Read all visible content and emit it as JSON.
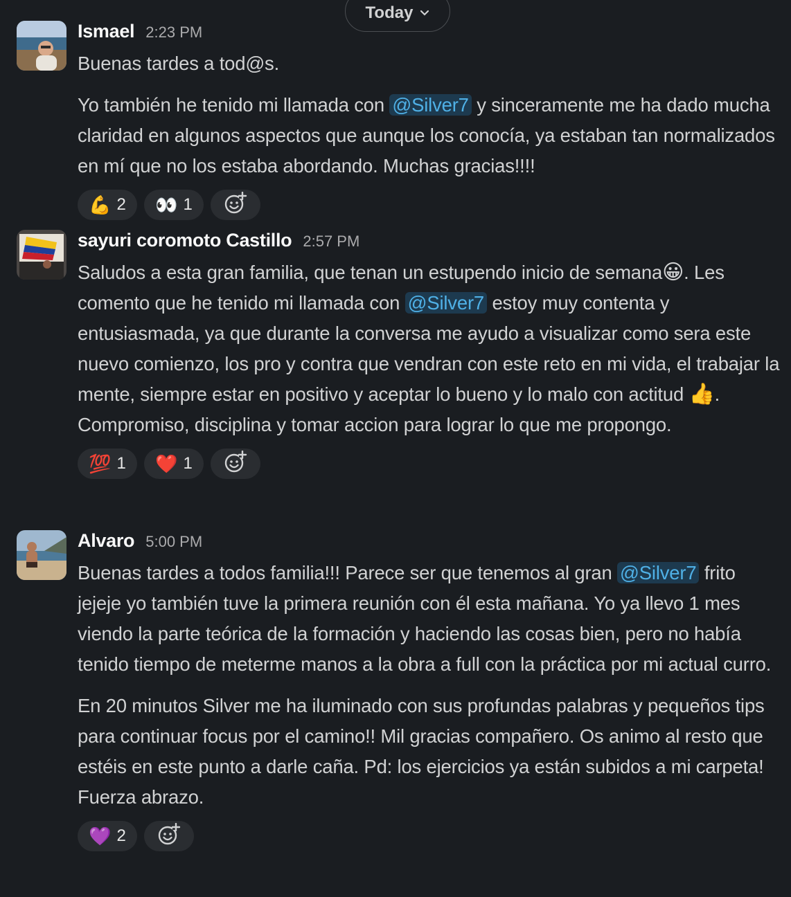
{
  "day_divider": {
    "label": "Today",
    "chevron_icon": "chevron-down-icon"
  },
  "colors": {
    "background": "#1a1d21",
    "mention_bg": "#1d3a4f",
    "mention_text": "#4fb0e6",
    "reaction_bg": "#2a2d31"
  },
  "messages": [
    {
      "author": "Ismael",
      "time": "2:23 PM",
      "line1": "Buenas tardes a tod@s.",
      "line2_pre": "Yo también he tenido mi llamada con ",
      "mention": "@Silver7",
      "line2_post": " y sinceramente me ha dado mucha claridad en algunos aspectos que aunque los conocía, ya estaban tan normalizados en mí que no los estaba abordando. Muchas gracias!!!!",
      "reactions": [
        {
          "emoji": "💪",
          "count": "2",
          "icon": "flexed-biceps-icon"
        },
        {
          "emoji": "👀",
          "count": "1",
          "icon": "eyes-icon"
        }
      ]
    },
    {
      "author": "sayuri coromoto Castillo",
      "time": "2:57 PM",
      "seg1": "Saludos a esta gran familia, que tenan un estupendo inicio de semana",
      "emoji1": "😀",
      "seg2": ". Les comento que he tenido mi llamada con ",
      "mention": "@Silver7",
      "seg3": " estoy muy contenta y entusiasmada, ya que durante la conversa me ayudo a visualizar como sera este nuevo comienzo, los pro y contra que vendran  con este reto en mi vida, el trabajar la mente, siempre estar en positivo  y aceptar lo bueno y lo malo con actitud ",
      "emoji2": "👍",
      "seg4": ". Compromiso, disciplina y tomar accion para lograr lo que me propongo.",
      "reactions": [
        {
          "emoji": "💯",
          "count": "1",
          "icon": "hundred-points-icon"
        },
        {
          "emoji": "❤️",
          "count": "1",
          "icon": "red-heart-icon"
        }
      ]
    },
    {
      "author": "Alvaro",
      "time": "5:00 PM",
      "p1_pre": "Buenas tardes a todos familia!!! Parece ser que tenemos al gran ",
      "mention": "@Silver7",
      "p1_post": " frito jejeje yo también tuve la primera reunión con él esta mañana. Yo ya llevo 1 mes viendo la parte teórica de la formación y haciendo las cosas bien, pero no había tenido tiempo de meterme manos a la obra a full con la práctica por mi actual curro.",
      "p2": "En 20 minutos Silver me ha iluminado con sus profundas palabras y pequeños tips para continuar focus por el camino!! Mil gracias compañero. Os animo al resto que estéis en este punto a darle caña. Pd: los ejercicios ya están subidos a mi carpeta! Fuerza abrazo.",
      "reactions": [
        {
          "emoji": "💜",
          "count": "2",
          "icon": "purple-heart-icon"
        }
      ]
    }
  ]
}
